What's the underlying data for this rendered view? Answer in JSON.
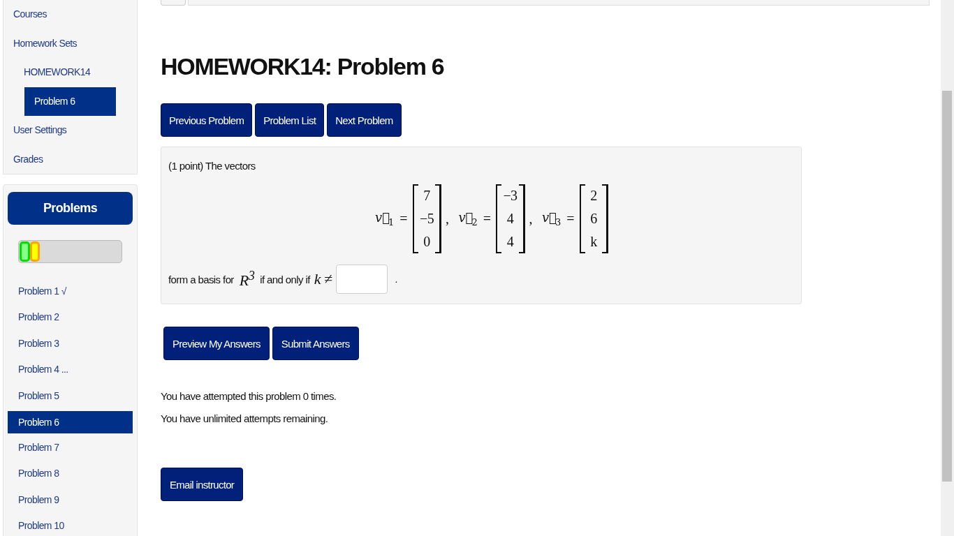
{
  "nav": {
    "items": [
      {
        "label": "Courses",
        "selected": false
      },
      {
        "label": "Homework Sets",
        "selected": false,
        "children": [
          {
            "label": "HOMEWORK14",
            "selected": false,
            "children": [
              {
                "label": "Problem 6",
                "selected": true
              }
            ]
          }
        ]
      },
      {
        "label": "User Settings",
        "selected": false
      },
      {
        "label": "Grades",
        "selected": false
      }
    ]
  },
  "problems_panel": {
    "title": "Problems",
    "progress": [
      {
        "kind": "correct",
        "level": 0.1
      },
      {
        "kind": "partial",
        "level": 0.1
      }
    ],
    "items": [
      {
        "label": "Problem 1 √",
        "selected": false
      },
      {
        "label": "Problem 2",
        "selected": false
      },
      {
        "label": "Problem 3",
        "selected": false
      },
      {
        "label": "Problem 4 ...",
        "selected": false
      },
      {
        "label": "Problem 5",
        "selected": false
      },
      {
        "label": "Problem 6",
        "selected": true
      },
      {
        "label": "Problem 7",
        "selected": false
      },
      {
        "label": "Problem 8",
        "selected": false
      },
      {
        "label": "Problem 9",
        "selected": false
      },
      {
        "label": "Problem 10",
        "selected": false
      }
    ]
  },
  "title": "HOMEWORK14: Problem 6",
  "nav_buttons": [
    "Previous Problem",
    "Problem List",
    "Next Problem"
  ],
  "problem": {
    "intro": "(1 point) The vectors",
    "vectors": [
      {
        "name": "v⃗",
        "index": "1",
        "equals": "=",
        "entries": [
          "7",
          "−5",
          "0"
        ],
        "separator": ","
      },
      {
        "name": "v⃗",
        "index": "2",
        "equals": "=",
        "entries": [
          "−3",
          "4",
          "4"
        ],
        "separator": ","
      },
      {
        "name": "v⃗",
        "index": "3",
        "equals": "=",
        "entries": [
          "2",
          "6",
          "k"
        ]
      }
    ],
    "answer_prefix": "form a basis for",
    "space": "R$^{3}$",
    "answer_middle": "if and only if",
    "condition": "k ≠",
    "answer_suffix": "."
  },
  "action_buttons": [
    "Preview My Answers",
    "Submit Answers"
  ],
  "messages": [
    "You have attempted this problem 0 times.",
    "You have unlimited attempts remaining."
  ],
  "email_button": "Email instructor"
}
